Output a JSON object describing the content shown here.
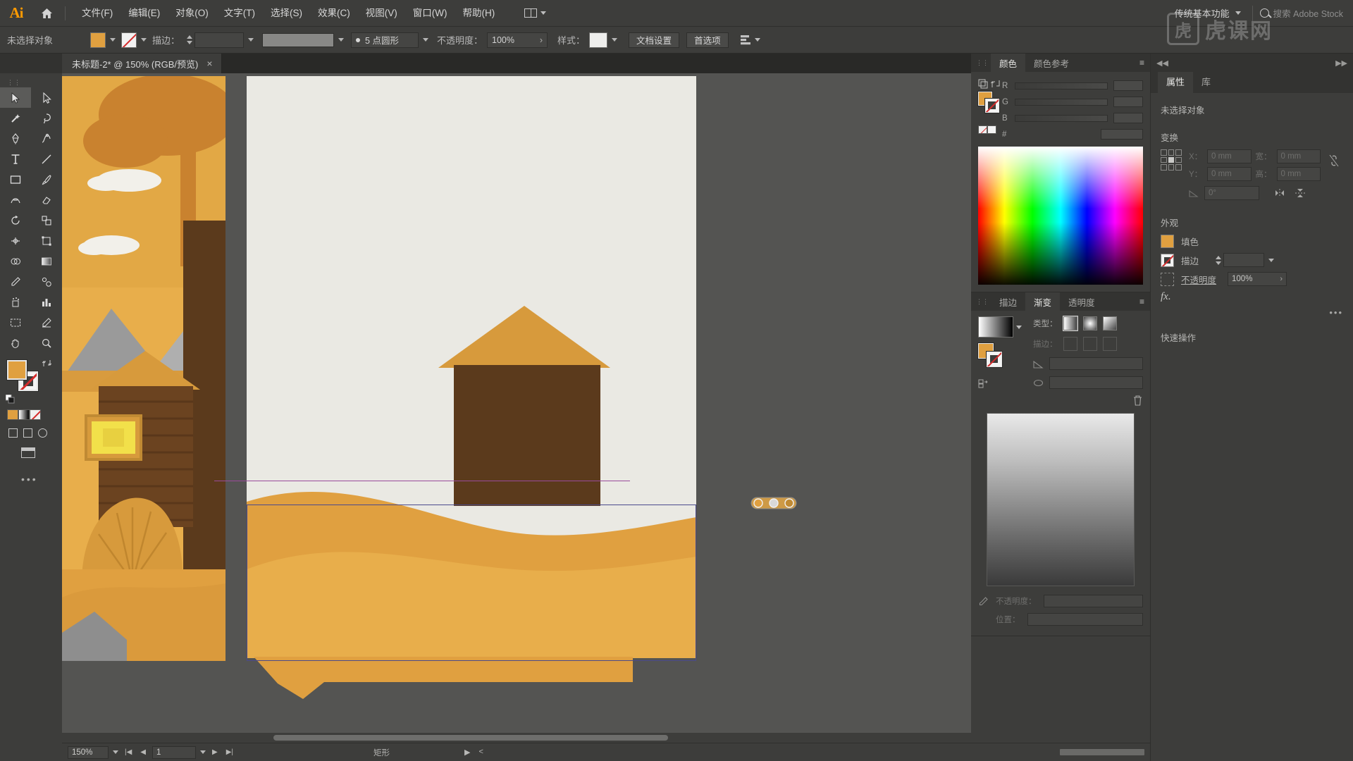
{
  "app": {
    "name": "Ai",
    "home_icon": "home-icon"
  },
  "menubar": {
    "items": [
      {
        "label": "文件(F)"
      },
      {
        "label": "编辑(E)"
      },
      {
        "label": "对象(O)"
      },
      {
        "label": "文字(T)"
      },
      {
        "label": "选择(S)"
      },
      {
        "label": "效果(C)"
      },
      {
        "label": "视图(V)"
      },
      {
        "label": "窗口(W)"
      },
      {
        "label": "帮助(H)"
      }
    ],
    "arrange_icon": "arrange-documents-icon",
    "workspace": "传统基本功能",
    "search_placeholder": "搜索 Adobe Stock"
  },
  "controlbar": {
    "selection_status": "未选择对象",
    "fill_color": "#E0A040",
    "stroke_color": "none",
    "stroke_label": "描边：",
    "stroke_weight": "",
    "stroke_profile": "5 点圆形",
    "opacity_label": "不透明度：",
    "opacity_value": "100%",
    "style_label": "样式：",
    "doc_setup_button": "文档设置",
    "preferences_button": "首选项",
    "align_icon": "align-icon"
  },
  "tabbar": {
    "document_title": "未标题-2* @ 150% (RGB/预览)",
    "close_icon": "close-icon"
  },
  "toolbar": {
    "tools": [
      {
        "name": "selection-tool",
        "glyph": "selection"
      },
      {
        "name": "direct-selection-tool",
        "glyph": "direct"
      },
      {
        "name": "magic-wand-tool",
        "glyph": "wand"
      },
      {
        "name": "lasso-tool",
        "glyph": "lasso"
      },
      {
        "name": "pen-tool",
        "glyph": "pen"
      },
      {
        "name": "curvature-tool",
        "glyph": "curvature"
      },
      {
        "name": "type-tool",
        "glyph": "type"
      },
      {
        "name": "line-segment-tool",
        "glyph": "line"
      },
      {
        "name": "rectangle-tool",
        "glyph": "rect"
      },
      {
        "name": "paintbrush-tool",
        "glyph": "brush"
      },
      {
        "name": "shaper-tool",
        "glyph": "shaper"
      },
      {
        "name": "eraser-tool",
        "glyph": "eraser"
      },
      {
        "name": "rotate-tool",
        "glyph": "rotate"
      },
      {
        "name": "scale-tool",
        "glyph": "scale"
      },
      {
        "name": "width-tool",
        "glyph": "width"
      },
      {
        "name": "free-transform-tool",
        "glyph": "freetransform"
      },
      {
        "name": "shape-builder-tool",
        "glyph": "shapebuilder"
      },
      {
        "name": "gradient-tool",
        "glyph": "gradient"
      },
      {
        "name": "eyedropper-tool",
        "glyph": "eyedropper"
      },
      {
        "name": "blend-tool",
        "glyph": "blend"
      },
      {
        "name": "symbol-sprayer-tool",
        "glyph": "symbol"
      },
      {
        "name": "column-graph-tool",
        "glyph": "graph"
      },
      {
        "name": "artboard-tool",
        "glyph": "artboard"
      },
      {
        "name": "slice-tool",
        "glyph": "slice"
      },
      {
        "name": "hand-tool",
        "glyph": "hand"
      },
      {
        "name": "zoom-tool",
        "glyph": "zoom"
      }
    ],
    "fill_color": "#E0A040",
    "stroke_color": "none",
    "more_icon": "more-options-icon"
  },
  "canvas": {
    "artboard_background": "#eae9e3",
    "canvas_background": "#545452",
    "selection_color": "#4a4a8c",
    "gradient_annotator": "gradient-annotator",
    "illustration": {
      "sky_color": "#E8AE4B",
      "sand_color": "#E0A040",
      "sand_dark": "#D2923A",
      "roof_color": "#D79A3C",
      "house_color": "#5B3A1C",
      "cloud_color": "#F2F0EA",
      "mountain_color": "#8E8E8E"
    }
  },
  "color_panel": {
    "tabs": [
      {
        "label": "颜色",
        "active": true
      },
      {
        "label": "颜色参考",
        "active": false
      }
    ],
    "channels": [
      {
        "label": "R",
        "value": ""
      },
      {
        "label": "G",
        "value": ""
      },
      {
        "label": "B",
        "value": ""
      }
    ],
    "hex_label": "#",
    "hex_value": "",
    "fill_swatch": "#E0A040",
    "menu_icon": "panel-menu-icon"
  },
  "gradient_panel": {
    "tabs": [
      {
        "label": "描边",
        "active": false
      },
      {
        "label": "渐变",
        "active": true
      },
      {
        "label": "透明度",
        "active": false
      }
    ],
    "type_label": "类型：",
    "stroke_label": "描边：",
    "angle_label": "角度：",
    "angle_value": "",
    "aspect_label": "长宽比：",
    "aspect_value": "",
    "opacity_label": "不透明度：",
    "location_label": "位置：",
    "preview_gradient": [
      "#ffffff",
      "#000000"
    ],
    "delete_icon": "delete-stop-icon",
    "eyedropper_icon": "eyedropper-icon",
    "menu_icon": "panel-menu-icon"
  },
  "properties_panel": {
    "tabs": [
      {
        "label": "属性",
        "active": true
      },
      {
        "label": "库",
        "active": false
      }
    ],
    "no_selection": "未选择对象",
    "transform": {
      "title": "变换",
      "x_label": "X：",
      "x_value": "0 mm",
      "y_label": "Y：",
      "y_value": "0 mm",
      "w_label": "宽：",
      "w_value": "0 mm",
      "h_label": "高：",
      "h_value": "0 mm",
      "angle_label": "∠:",
      "angle_value": "0°",
      "link_icon": "link-broken-icon",
      "flip_h_icon": "flip-horizontal-icon",
      "flip_v_icon": "flip-vertical-icon"
    },
    "appearance": {
      "title": "外观",
      "fill_label": "填色",
      "fill_color": "#E0A040",
      "stroke_label": "描边",
      "stroke_value": "",
      "opacity_label": "不透明度",
      "opacity_value": "100%",
      "fx_label": "fx."
    },
    "quick_actions": {
      "title": "快速操作"
    },
    "more_icon": "more-options-icon"
  },
  "icon_rail": {
    "icons": [
      {
        "name": "color-wheel-icon"
      },
      {
        "name": "swatches-icon"
      },
      {
        "name": "layers-icon"
      },
      {
        "name": "brushes-icon"
      },
      {
        "name": "symbols-icon"
      },
      {
        "name": "pathfinder-icon"
      },
      {
        "name": "align-panel-icon"
      },
      {
        "name": "transform-panel-icon"
      },
      {
        "name": "magic-wand-panel-icon"
      },
      {
        "name": "stroke-panel-icon"
      },
      {
        "name": "export-icon"
      },
      {
        "name": "artboards-icon"
      },
      {
        "name": "character-panel-icon"
      },
      {
        "name": "paragraph-panel-icon"
      }
    ]
  },
  "statusbar": {
    "zoom": "150%",
    "page_number": "1",
    "status_text": "矩形",
    "first_icon": "first-artboard-icon",
    "prev_icon": "prev-artboard-icon",
    "next_icon": "next-artboard-icon",
    "last_icon": "last-artboard-icon"
  },
  "watermark": {
    "letter": "虎",
    "text": "虎课网"
  }
}
